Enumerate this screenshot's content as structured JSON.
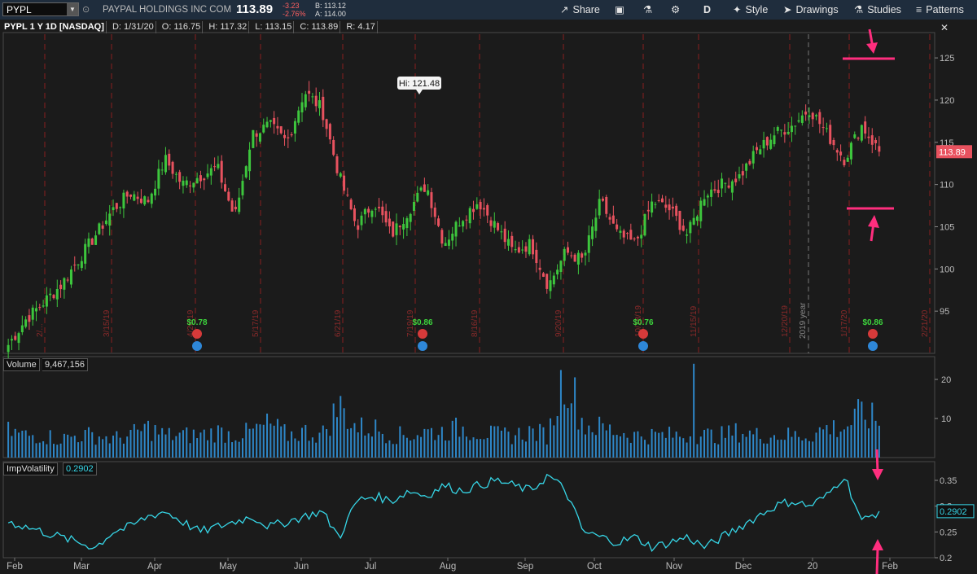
{
  "toolbar": {
    "symbol": "PYPL",
    "company": "PAYPAL HOLDINGS INC COM",
    "last": "113.89",
    "change": "-3.23",
    "change_pct": "-2.76%",
    "bid": "B: 113.12",
    "ask": "A: 114.00",
    "share": "Share",
    "period": "D",
    "style": "Style",
    "drawings": "Drawings",
    "studies": "Studies",
    "patterns": "Patterns"
  },
  "info": {
    "symbol": "PYPL 1 Y 1D [NASDAQ]",
    "date": "D: 1/31/20",
    "open": "O: 116.75",
    "high": "H: 117.32",
    "low": "L: 113.15",
    "close": "C: 113.89",
    "range": "R: 4.17"
  },
  "colors": {
    "up": "#3dc63d",
    "down": "#e8525f",
    "volume": "#2e87c8",
    "iv": "#36d6e7",
    "annotation": "#ff2e7e",
    "marker_line": "#8a1f1f"
  },
  "price_panel": {
    "hi_label": "Hi: 121.48",
    "last_badge": "113.89",
    "y_ticks": [
      "125",
      "120",
      "115",
      "110",
      "105",
      "100",
      "95"
    ],
    "year_label": "2019 year",
    "dividends": [
      {
        "amount": "$0.78",
        "date": "4/26/19"
      },
      {
        "amount": "$0.86",
        "date": "7/19/19"
      },
      {
        "amount": "$0.76",
        "date": "10/18/19"
      },
      {
        "amount": "$0.86",
        "date": "1/17/20"
      }
    ],
    "date_markers": [
      "2/...",
      "3/15/19",
      "4/26/19",
      "5/17/19",
      "6/21/19",
      "7/19/19",
      "8/16/19",
      "9/20/19",
      "10/18/19",
      "11/15/19",
      "12/20/19",
      "1/17/20",
      "2/21/20"
    ]
  },
  "volume_panel": {
    "label": "Volume",
    "value": "9,467,156",
    "y_ticks": [
      "20",
      "10"
    ]
  },
  "iv_panel": {
    "label": "ImpVolatility",
    "value": "0.2902",
    "badge": "0.2902",
    "y_ticks": [
      "0.35",
      "0.3",
      "0.25",
      "0.2"
    ]
  },
  "x_axis": [
    "Feb",
    "Mar",
    "Apr",
    "May",
    "Jun",
    "Jul",
    "Aug",
    "Sep",
    "Oct",
    "Nov",
    "Dec",
    "20",
    "Feb"
  ],
  "chart_data": [
    {
      "type": "candlestick",
      "title": "PYPL 1 Y 1D [NASDAQ]",
      "ylim": [
        90,
        128
      ],
      "x": [
        "Feb",
        "Mar",
        "Apr",
        "May",
        "Jun",
        "Jul",
        "Aug",
        "Sep",
        "Oct",
        "Nov",
        "Dec",
        "20",
        "Feb"
      ],
      "close_path": [
        91,
        94,
        96,
        98,
        101,
        104,
        107,
        109,
        108,
        113,
        110,
        111,
        112,
        106,
        116,
        117,
        115,
        121,
        119,
        111,
        105,
        108,
        104,
        107,
        110,
        103,
        106,
        108,
        105,
        102,
        103,
        98,
        102,
        101,
        108,
        104,
        103,
        108,
        107,
        104,
        109,
        110,
        111,
        114,
        116,
        117,
        119,
        116,
        113,
        117,
        113.89
      ],
      "hi": 121.48,
      "last": 113.89,
      "dividends": [
        0.78,
        0.86,
        0.76,
        0.86
      ]
    },
    {
      "type": "bar",
      "title": "Volume",
      "ylim": [
        0,
        25
      ],
      "unit": "millions",
      "values": [
        7,
        6,
        6,
        5,
        6,
        6,
        5,
        6,
        8,
        6,
        6,
        6,
        7,
        6,
        7,
        9,
        6,
        7,
        6,
        14,
        8,
        8,
        6,
        6,
        7,
        7,
        8,
        7,
        6,
        6,
        7,
        6,
        24,
        9,
        8,
        7,
        6,
        6,
        6,
        6,
        6,
        6,
        7,
        6,
        6,
        6,
        6,
        8,
        8,
        12,
        9.47
      ]
    },
    {
      "type": "line",
      "title": "ImpVolatility",
      "ylim": [
        0.2,
        0.38
      ],
      "values": [
        0.27,
        0.26,
        0.25,
        0.24,
        0.23,
        0.22,
        0.25,
        0.26,
        0.28,
        0.29,
        0.27,
        0.25,
        0.26,
        0.27,
        0.28,
        0.26,
        0.27,
        0.28,
        0.29,
        0.24,
        0.31,
        0.32,
        0.31,
        0.33,
        0.32,
        0.34,
        0.33,
        0.34,
        0.35,
        0.34,
        0.33,
        0.36,
        0.33,
        0.25,
        0.24,
        0.23,
        0.24,
        0.22,
        0.23,
        0.24,
        0.22,
        0.24,
        0.26,
        0.28,
        0.3,
        0.31,
        0.3,
        0.32,
        0.36,
        0.27,
        0.2902
      ]
    }
  ]
}
